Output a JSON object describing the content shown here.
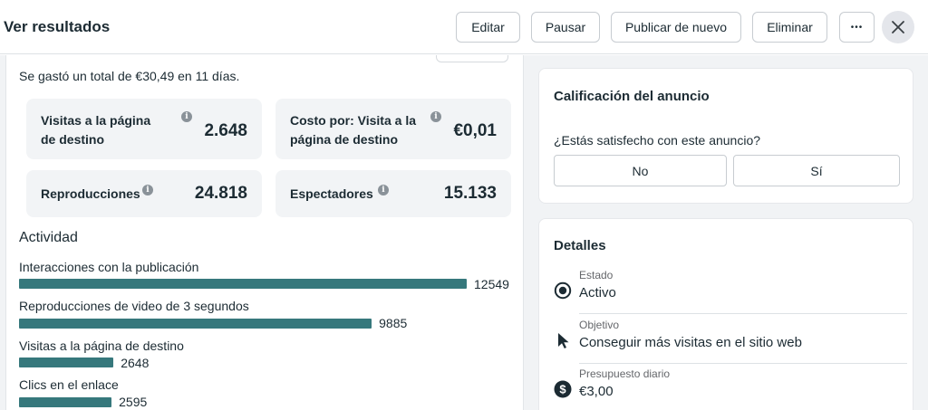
{
  "header": {
    "title": "Ver resultados",
    "buttons": {
      "edit": "Editar",
      "pause": "Pausar",
      "republish": "Publicar de nuevo",
      "delete": "Eliminar",
      "more": "•••"
    },
    "close_icon": "close-icon"
  },
  "summary": "Se gastó un total de €30,49 en 11 días.",
  "metrics": [
    {
      "label": "Visitas a la página de destino",
      "value": "2.648"
    },
    {
      "label": "Costo por: Visita a la página de destino",
      "value": "€0,01"
    },
    {
      "label": "Reproducciones",
      "value": "24.818"
    },
    {
      "label": "Espectadores",
      "value": "15.133"
    }
  ],
  "activity": {
    "title": "Actividad",
    "color": "#36787c",
    "max": 12549,
    "items": [
      {
        "label": "Interacciones con la publicación",
        "value": 12549,
        "value_text": "12549"
      },
      {
        "label": "Reproducciones de video de 3 segundos",
        "value": 9885,
        "value_text": "9885"
      },
      {
        "label": "Visitas a la página de destino",
        "value": 2648,
        "value_text": "2648"
      },
      {
        "label": "Clics en el enlace",
        "value": 2595,
        "value_text": "2595"
      }
    ]
  },
  "rating": {
    "title": "Calificación del anuncio",
    "question": "¿Estás satisfecho con este anuncio?",
    "no": "No",
    "yes": "Sí"
  },
  "details": {
    "title": "Detalles",
    "items": [
      {
        "label": "Estado",
        "value": "Activo",
        "icon": "radio-selected-icon"
      },
      {
        "label": "Objetivo",
        "value": "Conseguir más visitas en el sitio web",
        "icon": "cursor-icon"
      },
      {
        "label": "Presupuesto diario",
        "value": "€3,00",
        "icon": "dollar-circle-icon"
      }
    ]
  }
}
